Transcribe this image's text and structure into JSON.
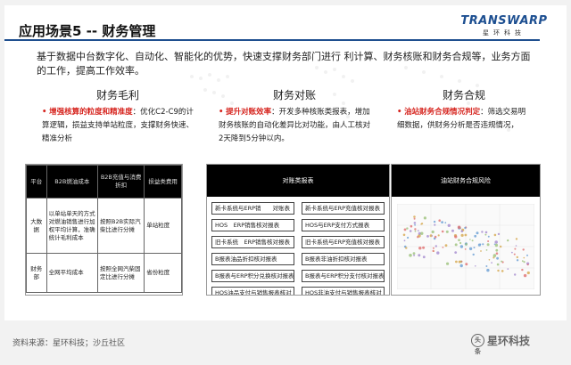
{
  "slide": {
    "title": "应用场景5 -- 财务管理",
    "intro": "基于数据中台数字化、自动化、智能化的优势，快速支撑财务部门进行 利计算、财务核账和财务合规等，业务方面的工作，提高工作效率。"
  },
  "logo": {
    "main": "TRANSWARP",
    "sub": "星环科技"
  },
  "columns": [
    {
      "title": "财务毛利",
      "highlight": "增强核算的粒度和精准度",
      "body": "：优化C2-C9的计算逻辑，损益支持单站粒度，支撑财务快速、精准分析"
    },
    {
      "title": "财务对账",
      "highlight": "提升对账效率",
      "body": "：开发多种核账类报表，增加财务核账的自动化差异比对功能，由人工核对2天降到5分钟以内。"
    },
    {
      "title": "财务合规",
      "highlight": "油站财务合规情况判定",
      "body": "：筛选交易明细数据，供财务分析是否违规情况，"
    }
  ],
  "table1": {
    "headers": [
      "平台",
      "B2B燃油成本",
      "B2B充值与消费折扣",
      "损益类费用"
    ],
    "rows": [
      [
        "大数据",
        "以单站单天的方式对燃油销售进行加权平均计算，准确统计毛利成本",
        "按照B2B实际汽柴比进行分摊",
        "单站粒度"
      ],
      [
        "财务部",
        "全网平均成本",
        "按照全网汽柴固定比进行分摊",
        "省份粒度"
      ]
    ]
  },
  "panel2": {
    "title": "对账类报表",
    "items": [
      "新卡系统与ERP销　　对账表",
      "新卡系统与ERP充值核对报表",
      "HOS　ERP销售核对报表",
      "HOS与ERP支付方式报表",
      "旧卡系统　ERP销售核对报表",
      "旧卡系统与ERP充值核对报表",
      "B报表油品折扣核对报表",
      "B报表非油折扣核对报表",
      "B报表与ERP积分兑换核对报表",
      "B报表与ERP积分支付核对报表",
      "HOS油品支付与销售报表核对",
      "HOS非油支付与销售报表核对"
    ]
  },
  "panel3": {
    "title": "油站财务合规风险"
  },
  "footer": {
    "source": "资料来源：星环科技；沙丘社区",
    "watermark": "星环科技",
    "watermark_icon": "头条"
  }
}
